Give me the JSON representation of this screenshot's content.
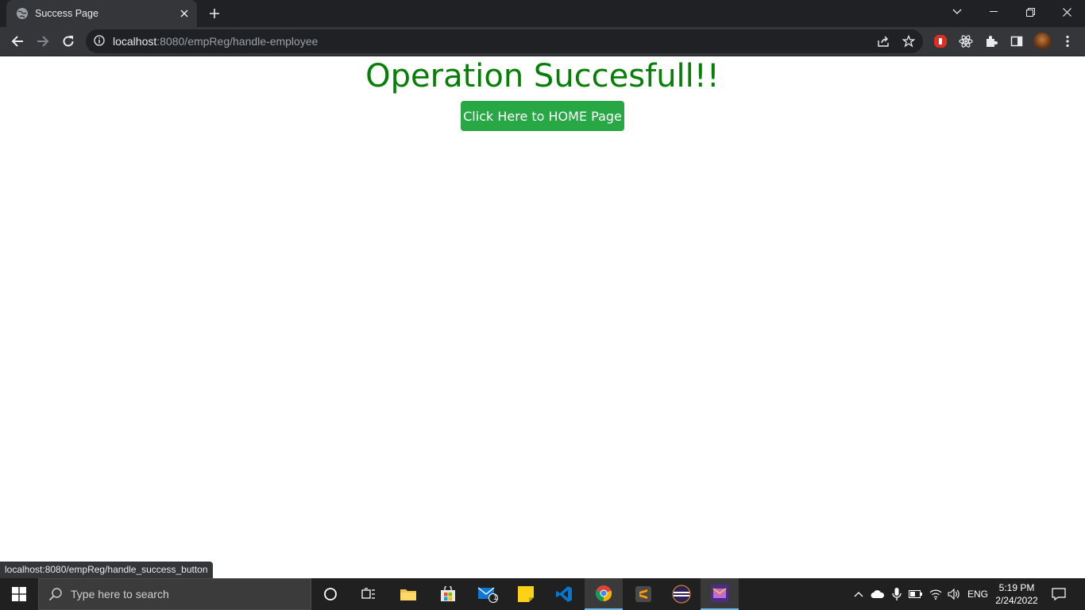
{
  "browser": {
    "tab_title": "Success Page",
    "url_host": "localhost",
    "url_rest": ":8080/empReg/handle-employee",
    "status_url": "localhost:8080/empReg/handle_success_button"
  },
  "page": {
    "heading": "Operation Succesfull!!",
    "home_button_label": "Click Here to HOME Page",
    "heading_color": "#058005",
    "button_color": "#28a745"
  },
  "taskbar": {
    "search_placeholder": "Type here to search",
    "mail_badge": "1",
    "language": "ENG",
    "time": "5:19 PM",
    "date": "2/24/2022"
  }
}
